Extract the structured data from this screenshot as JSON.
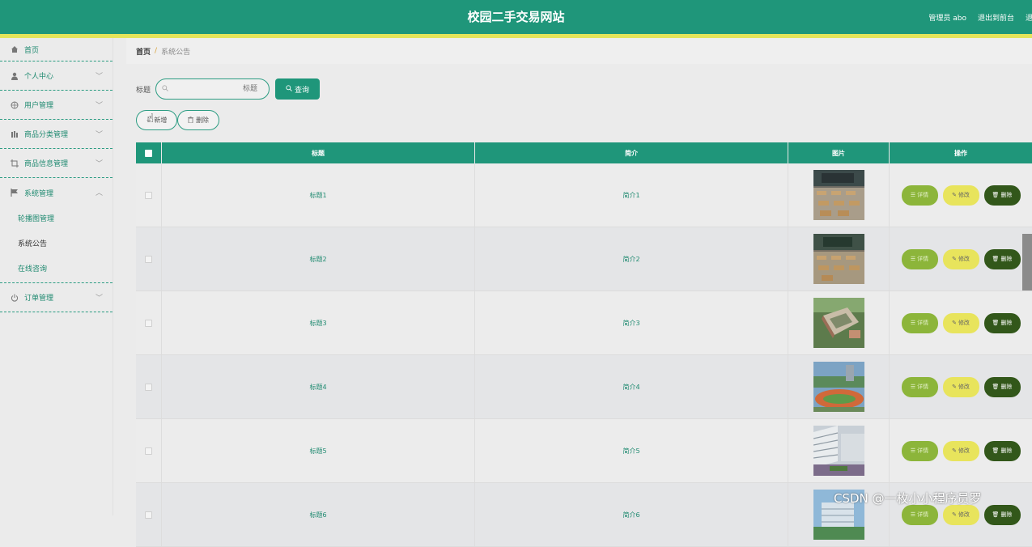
{
  "header": {
    "title": "校园二手交易网站",
    "admin_label": "管理员 abo",
    "back_front": "退出到前台",
    "logout": "退出"
  },
  "sidebar": {
    "home": "首页",
    "items": [
      {
        "label": "个人中心"
      },
      {
        "label": "用户管理"
      },
      {
        "label": "商品分类管理"
      },
      {
        "label": "商品信息管理"
      },
      {
        "label": "系统管理"
      }
    ],
    "system_sub": [
      "轮播图管理",
      "系统公告",
      "在线咨询"
    ],
    "order": "订单管理"
  },
  "breadcrumb": {
    "home": "首页",
    "sep": "/",
    "current": "系统公告"
  },
  "search": {
    "label": "标题",
    "placeholder": "标题",
    "button": "查询"
  },
  "actions": {
    "add": "新增",
    "delete": "删除"
  },
  "table": {
    "headers": {
      "title": "标题",
      "intro": "简介",
      "pic": "图片",
      "op": "操作"
    },
    "rows": [
      {
        "title": "标题1",
        "intro": "简介1"
      },
      {
        "title": "标题2",
        "intro": "简介2"
      },
      {
        "title": "标题3",
        "intro": "简介3"
      },
      {
        "title": "标题4",
        "intro": "简介4"
      },
      {
        "title": "标题5",
        "intro": "简介5"
      },
      {
        "title": "标题6",
        "intro": "简介6"
      }
    ],
    "row_actions": {
      "detail": "详情",
      "edit": "修改",
      "delete": "删除"
    }
  },
  "watermark": "CSDN @一枚小小程序员罗",
  "colors": {
    "primary": "#1f967a",
    "stripe": "#e4e45a",
    "detail": "#8cb53a",
    "edit": "#e8e45c",
    "delete": "#32571a"
  }
}
